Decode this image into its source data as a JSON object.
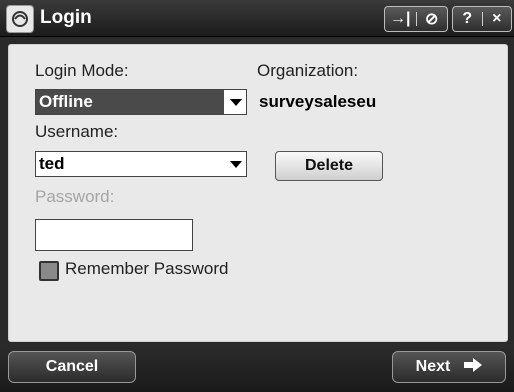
{
  "window": {
    "title": "Login",
    "title_buttons": {
      "group1": [
        "→|",
        "⊘"
      ],
      "group2": [
        "?",
        "×"
      ]
    }
  },
  "form": {
    "login_mode_label": "Login Mode:",
    "login_mode_value": "Offline",
    "organization_label": "Organization:",
    "organization_value": "surveysaleseu",
    "username_label": "Username:",
    "username_value": "ted",
    "delete_label": "Delete",
    "password_label": "Password:",
    "password_value": "",
    "remember_label": "Remember Password",
    "remember_checked": false
  },
  "softkeys": {
    "left": "Cancel",
    "right": "Next"
  },
  "icons": {
    "app": "app-logo-icon",
    "next": "arrow-right-icon",
    "dropdown": "chevron-down-icon"
  }
}
